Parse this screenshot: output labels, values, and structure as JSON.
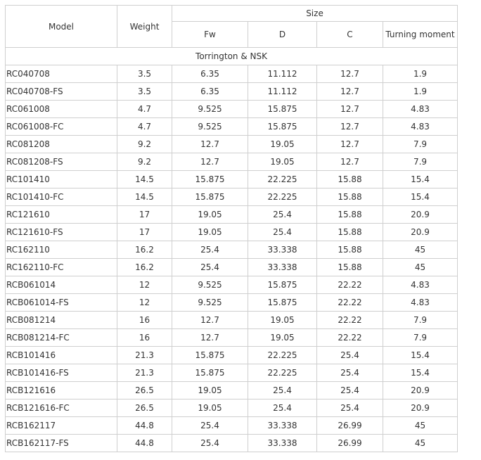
{
  "headers": {
    "model": "Model",
    "weight": "Weight",
    "size": "Size",
    "fw": "Fw",
    "d": "D",
    "c": "C",
    "turning_moment": "Turning moment"
  },
  "group_label": "Torrington & NSK",
  "rows": [
    [
      "RC040708",
      "3.5",
      "6.35",
      "11.112",
      "12.7",
      "1.9"
    ],
    [
      "RC040708-FS",
      "3.5",
      "6.35",
      "11.112",
      "12.7",
      "1.9"
    ],
    [
      "RC061008",
      "4.7",
      "9.525",
      "15.875",
      "12.7",
      "4.83"
    ],
    [
      "RC061008-FC",
      "4.7",
      "9.525",
      "15.875",
      "12.7",
      "4.83"
    ],
    [
      "RC081208",
      "9.2",
      "12.7",
      "19.05",
      "12.7",
      "7.9"
    ],
    [
      "RC081208-FS",
      "9.2",
      "12.7",
      "19.05",
      "12.7",
      "7.9"
    ],
    [
      "RC101410",
      "14.5",
      "15.875",
      "22.225",
      "15.88",
      "15.4"
    ],
    [
      "RC101410-FC",
      "14.5",
      "15.875",
      "22.225",
      "15.88",
      "15.4"
    ],
    [
      "RC121610",
      "17",
      "19.05",
      "25.4",
      "15.88",
      "20.9"
    ],
    [
      "RC121610-FS",
      "17",
      "19.05",
      "25.4",
      "15.88",
      "20.9"
    ],
    [
      "RC162110",
      "16.2",
      "25.4",
      "33.338",
      "15.88",
      "45"
    ],
    [
      "RC162110-FC",
      "16.2",
      "25.4",
      "33.338",
      "15.88",
      "45"
    ],
    [
      "RCB061014",
      "12",
      "9.525",
      "15.875",
      "22.22",
      "4.83"
    ],
    [
      "RCB061014-FS",
      "12",
      "9.525",
      "15.875",
      "22.22",
      "4.83"
    ],
    [
      "RCB081214",
      "16",
      "12.7",
      "19.05",
      "22.22",
      "7.9"
    ],
    [
      "RCB081214-FC",
      "16",
      "12.7",
      "19.05",
      "22.22",
      "7.9"
    ],
    [
      "RCB101416",
      "21.3",
      "15.875",
      "22.225",
      "25.4",
      "15.4"
    ],
    [
      "RCB101416-FS",
      "21.3",
      "15.875",
      "22.225",
      "25.4",
      "15.4"
    ],
    [
      "RCB121616",
      "26.5",
      "19.05",
      "25.4",
      "25.4",
      "20.9"
    ],
    [
      "RCB121616-FC",
      "26.5",
      "19.05",
      "25.4",
      "25.4",
      "20.9"
    ],
    [
      "RCB162117",
      "44.8",
      "25.4",
      "33.338",
      "26.99",
      "45"
    ],
    [
      "RCB162117-FS",
      "44.8",
      "25.4",
      "33.338",
      "26.99",
      "45"
    ]
  ]
}
